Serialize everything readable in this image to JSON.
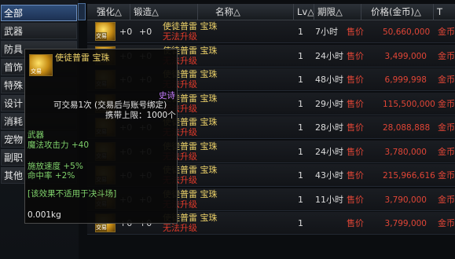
{
  "sidebar": {
    "items": [
      {
        "label": "全部"
      },
      {
        "label": "武器"
      },
      {
        "label": "防具"
      },
      {
        "label": "首饰"
      },
      {
        "label": "特殊"
      },
      {
        "label": "设计"
      },
      {
        "label": "消耗"
      },
      {
        "label": "宠物"
      },
      {
        "label": "副职"
      },
      {
        "label": "其他"
      }
    ]
  },
  "header": {
    "col_enhance": "强化△",
    "col_forge": "锻造△",
    "col_name": "名称△",
    "col_lv": "Lv△",
    "col_expire": "期限△",
    "col_price": "价格(金币)△",
    "col_extra": "T"
  },
  "rows": [
    {
      "enhance": "+0",
      "forge": "+0",
      "name1": "使徒普雷 宝珠",
      "name2": "无法升级",
      "qty": "1",
      "time": "7小时",
      "price_label": "售价",
      "price": "50,660,000",
      "currency": "金币",
      "icon_text": "交易"
    },
    {
      "enhance": "+0",
      "forge": "+0",
      "name1": "使徒普雷 宝珠",
      "name2": "无法升级",
      "qty": "1",
      "time": "24小时",
      "price_label": "售价",
      "price": "3,499,000",
      "currency": "金币",
      "icon_text": "交易"
    },
    {
      "enhance": "+0",
      "forge": "+0",
      "name1": "使徒普雷 宝珠",
      "name2": "无法升级",
      "qty": "1",
      "time": "48小时",
      "price_label": "售价",
      "price": "6,999,998",
      "currency": "金币",
      "icon_text": "交易"
    },
    {
      "enhance": "+0",
      "forge": "+0",
      "name1": "使徒普雷 宝珠",
      "name2": "无法升级",
      "qty": "1",
      "time": "29小时",
      "price_label": "售价",
      "price": "115,500,000",
      "currency": "金币",
      "icon_text": "交易"
    },
    {
      "enhance": "+0",
      "forge": "+0",
      "name1": "使徒普雷 宝珠",
      "name2": "无法升级",
      "qty": "1",
      "time": "28小时",
      "price_label": "售价",
      "price": "28,088,888",
      "currency": "金币",
      "icon_text": "交易"
    },
    {
      "enhance": "+0",
      "forge": "+0",
      "name1": "使徒普雷 宝珠",
      "name2": "无法升级",
      "qty": "1",
      "time": "24小时",
      "price_label": "售价",
      "price": "3,780,000",
      "currency": "金币",
      "icon_text": "交易"
    },
    {
      "enhance": "+0",
      "forge": "+0",
      "name1": "使徒普雷 宝珠",
      "name2": "无法升级",
      "qty": "1",
      "time": "43小时",
      "price_label": "售价",
      "price": "215,966,616",
      "currency": "金币",
      "icon_text": "交易"
    },
    {
      "enhance": "+0",
      "forge": "+0",
      "name1": "使徒普雷 宝珠",
      "name2": "无法升级",
      "qty": "1",
      "time": "11小时",
      "price_label": "售价",
      "price": "3,790,000",
      "currency": "金币",
      "icon_text": "交易"
    },
    {
      "enhance": "+0",
      "forge": "+0",
      "name1": "使徒普雷 宝珠",
      "name2": "无法升级",
      "qty": "1",
      "time": "",
      "price_label": "售价",
      "price": "3,799,000",
      "currency": "金币",
      "icon_text": "交易"
    }
  ],
  "tooltip": {
    "title": "使徒普雷 宝珠",
    "icon_text": "交易",
    "rarity": "史诗",
    "trade": "可交易1次 (交易后与账号绑定)",
    "limit": "携带上限：1000个",
    "type": "武器",
    "stat1": "魔法攻击力 +40",
    "stat2": "施放速度 +5%",
    "stat3": "命中率 +2%",
    "note": "[该效果不适用于决斗场]",
    "weight": "0.001kg"
  },
  "colors": {
    "gold_name": "#f0d46a",
    "red": "#e03a2a",
    "green_stat": "#7fd16b",
    "rarity_purple": "#c77dff",
    "selected_tab": "#2f4e7a"
  }
}
